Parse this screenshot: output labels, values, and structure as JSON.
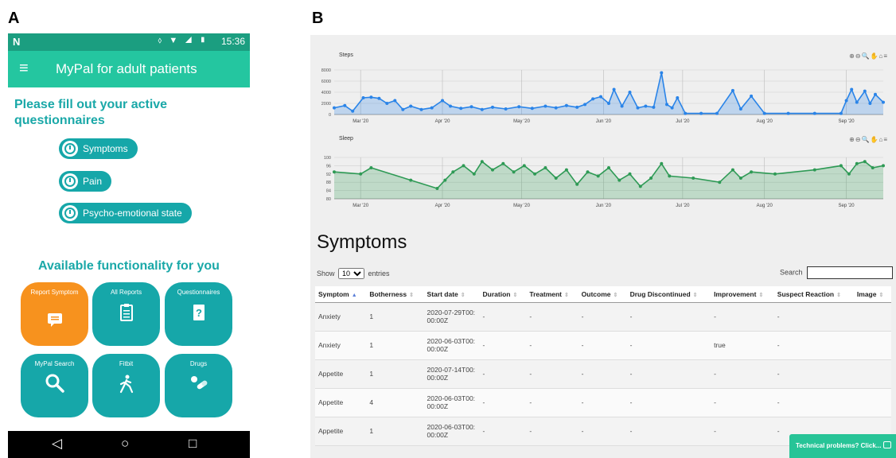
{
  "labels": {
    "a": "A",
    "b": "B"
  },
  "phone": {
    "status": {
      "carrier_icon": "N",
      "icons": "vibrate-icon wifi-icon signal-icon battery-icon",
      "time": "15:36"
    },
    "appbar": {
      "menu_icon": "hamburger-icon",
      "title": "MyPal for adult patients"
    },
    "questionnaire_heading": "Please fill out your active questionnaires",
    "questionnaires": [
      {
        "label": "Symptoms",
        "icon": "clock-icon"
      },
      {
        "label": "Pain",
        "icon": "clock-icon"
      },
      {
        "label": "Psycho-emotional state",
        "icon": "clock-icon"
      }
    ],
    "functionality_heading": "Available functionality for you",
    "tiles": [
      {
        "label": "Report Symptom",
        "icon": "chat-icon",
        "color": "#f7921e"
      },
      {
        "label": "All Reports",
        "icon": "clipboard-icon",
        "color": "#16a7a9"
      },
      {
        "label": "Questionnaires",
        "icon": "question-book-icon",
        "color": "#16a7a9"
      },
      {
        "label": "MyPal Search",
        "icon": "search-icon",
        "color": "#16a7a9"
      },
      {
        "label": "Fitbit",
        "icon": "walking-icon",
        "color": "#16a7a9"
      },
      {
        "label": "Drugs",
        "icon": "pills-icon",
        "color": "#16a7a9"
      }
    ],
    "navbar": {
      "back": "◁",
      "home": "○",
      "recent": "□"
    }
  },
  "web": {
    "chart_data": [
      {
        "type": "area",
        "title": "Steps",
        "color": "#2a84e8",
        "yticks": [
          "8000",
          "6000",
          "4000",
          "2000",
          "0"
        ],
        "ylim": [
          0,
          8000
        ],
        "xticks": [
          "Mar '20",
          "Apr '20",
          "May '20",
          "Jun '20",
          "Jul '20",
          "Aug '20",
          "Sep '20"
        ],
        "x_range": [
          "2020-02-20",
          "2020-09-15"
        ],
        "series": [
          {
            "values": [
              [
                "2020-02-20",
                1200
              ],
              [
                "2020-02-24",
                1600
              ],
              [
                "2020-02-27",
                600
              ],
              [
                "2020-03-02",
                3000
              ],
              [
                "2020-03-05",
                3100
              ],
              [
                "2020-03-08",
                2900
              ],
              [
                "2020-03-11",
                2000
              ],
              [
                "2020-03-14",
                2500
              ],
              [
                "2020-03-17",
                900
              ],
              [
                "2020-03-20",
                1500
              ],
              [
                "2020-03-24",
                900
              ],
              [
                "2020-03-28",
                1200
              ],
              [
                "2020-04-01",
                2500
              ],
              [
                "2020-04-04",
                1500
              ],
              [
                "2020-04-08",
                1100
              ],
              [
                "2020-04-12",
                1400
              ],
              [
                "2020-04-16",
                900
              ],
              [
                "2020-04-20",
                1300
              ],
              [
                "2020-04-25",
                1000
              ],
              [
                "2020-04-30",
                1400
              ],
              [
                "2020-05-05",
                1100
              ],
              [
                "2020-05-10",
                1500
              ],
              [
                "2020-05-14",
                1200
              ],
              [
                "2020-05-18",
                1600
              ],
              [
                "2020-05-22",
                1300
              ],
              [
                "2020-05-25",
                1800
              ],
              [
                "2020-05-28",
                2800
              ],
              [
                "2020-05-31",
                3200
              ],
              [
                "2020-06-03",
                2000
              ],
              [
                "2020-06-05",
                4500
              ],
              [
                "2020-06-08",
                1500
              ],
              [
                "2020-06-11",
                4000
              ],
              [
                "2020-06-14",
                1200
              ],
              [
                "2020-06-17",
                1500
              ],
              [
                "2020-06-20",
                1300
              ],
              [
                "2020-06-23",
                7500
              ],
              [
                "2020-06-25",
                1800
              ],
              [
                "2020-06-27",
                1200
              ],
              [
                "2020-06-29",
                3000
              ],
              [
                "2020-07-02",
                200
              ],
              [
                "2020-07-08",
                200
              ],
              [
                "2020-07-14",
                200
              ],
              [
                "2020-07-20",
                4300
              ],
              [
                "2020-07-23",
                1000
              ],
              [
                "2020-07-27",
                3300
              ],
              [
                "2020-08-01",
                200
              ],
              [
                "2020-08-10",
                200
              ],
              [
                "2020-08-20",
                200
              ],
              [
                "2020-08-30",
                200
              ],
              [
                "2020-09-01",
                2500
              ],
              [
                "2020-09-03",
                4500
              ],
              [
                "2020-09-05",
                2200
              ],
              [
                "2020-09-08",
                4200
              ],
              [
                "2020-09-10",
                2000
              ],
              [
                "2020-09-12",
                3600
              ],
              [
                "2020-09-15",
                2200
              ]
            ]
          }
        ],
        "toolbar": "⊕⊖🔍✋⌂≡"
      },
      {
        "type": "area",
        "title": "Sleep",
        "color": "#2e9a55",
        "yticks": [
          "100",
          "96",
          "92",
          "88",
          "84",
          "80"
        ],
        "ylim": [
          80,
          100
        ],
        "xticks": [
          "Mar '20",
          "Apr '20",
          "May '20",
          "Jun '20",
          "Jul '20",
          "Aug '20",
          "Sep '20"
        ],
        "x_range": [
          "2020-02-20",
          "2020-09-15"
        ],
        "series": [
          {
            "values": [
              [
                "2020-02-20",
                93
              ],
              [
                "2020-03-01",
                92
              ],
              [
                "2020-03-05",
                95
              ],
              [
                "2020-03-20",
                89
              ],
              [
                "2020-03-30",
                85
              ],
              [
                "2020-04-02",
                89
              ],
              [
                "2020-04-05",
                93
              ],
              [
                "2020-04-09",
                96
              ],
              [
                "2020-04-13",
                92
              ],
              [
                "2020-04-16",
                98
              ],
              [
                "2020-04-20",
                94
              ],
              [
                "2020-04-24",
                97
              ],
              [
                "2020-04-28",
                93
              ],
              [
                "2020-05-02",
                96
              ],
              [
                "2020-05-06",
                92
              ],
              [
                "2020-05-10",
                95
              ],
              [
                "2020-05-14",
                90
              ],
              [
                "2020-05-18",
                94
              ],
              [
                "2020-05-22",
                87
              ],
              [
                "2020-05-26",
                93
              ],
              [
                "2020-05-30",
                91
              ],
              [
                "2020-06-03",
                95
              ],
              [
                "2020-06-07",
                89
              ],
              [
                "2020-06-11",
                92
              ],
              [
                "2020-06-15",
                86
              ],
              [
                "2020-06-19",
                90
              ],
              [
                "2020-06-23",
                97
              ],
              [
                "2020-06-26",
                91
              ],
              [
                "2020-07-05",
                90
              ],
              [
                "2020-07-15",
                88
              ],
              [
                "2020-07-20",
                94
              ],
              [
                "2020-07-23",
                90
              ],
              [
                "2020-07-27",
                93
              ],
              [
                "2020-08-05",
                92
              ],
              [
                "2020-08-20",
                94
              ],
              [
                "2020-08-30",
                96
              ],
              [
                "2020-09-02",
                92
              ],
              [
                "2020-09-05",
                97
              ],
              [
                "2020-09-08",
                98
              ],
              [
                "2020-09-11",
                95
              ],
              [
                "2020-09-15",
                96
              ]
            ]
          }
        ],
        "toolbar": "⊕⊖🔍✋⌂≡"
      }
    ],
    "symptoms_title": "Symptoms",
    "show": {
      "prefix": "Show",
      "value": "10",
      "suffix": "entries"
    },
    "search_label": "Search",
    "columns": [
      "Symptom",
      "Botherness",
      "Start date",
      "Duration",
      "Treatment",
      "Outcome",
      "Drug Discontinued",
      "Improvement",
      "Suspect Reaction",
      "Image"
    ],
    "rows": [
      [
        "Anxiety",
        "1",
        "2020-07-29T00:00:00Z",
        "-",
        "-",
        "-",
        "-",
        "-",
        "-",
        ""
      ],
      [
        "Anxiety",
        "1",
        "2020-06-03T00:00:00Z",
        "-",
        "-",
        "-",
        "-",
        "true",
        "-",
        ""
      ],
      [
        "Appetite",
        "1",
        "2020-07-14T00:00:00Z",
        "-",
        "-",
        "-",
        "-",
        "-",
        "-",
        ""
      ],
      [
        "Appetite",
        "4",
        "2020-06-03T00:00:00Z",
        "-",
        "-",
        "-",
        "-",
        "-",
        "-",
        ""
      ],
      [
        "Appetite",
        "1",
        "2020-06-03T00:00:00Z",
        "-",
        "-",
        "-",
        "-",
        "-",
        "-",
        ""
      ]
    ],
    "tech_button": "Technical problems? Click..."
  }
}
